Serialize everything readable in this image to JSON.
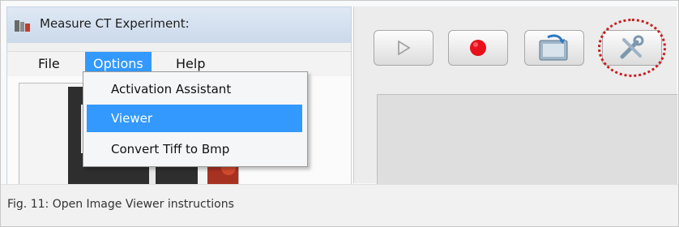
{
  "window": {
    "title": "Measure CT Experiment:"
  },
  "menubar": {
    "items": [
      {
        "label": "File"
      },
      {
        "label": "Options"
      },
      {
        "label": "Help"
      }
    ],
    "active_item": "Options"
  },
  "options_menu": {
    "items": [
      {
        "label": "Activation Assistant",
        "selected": false
      },
      {
        "label": "Viewer",
        "selected": true
      },
      {
        "label": "Convert Tiff to Bmp",
        "selected": false
      }
    ]
  },
  "toolbar": {
    "buttons": [
      {
        "icon": "play-icon"
      },
      {
        "icon": "record-icon"
      },
      {
        "icon": "export-image-icon"
      },
      {
        "icon": "tools-icon",
        "highlighted": true
      }
    ]
  },
  "colors": {
    "menu_highlight": "#3399ff",
    "record_red": "#e8101a",
    "annotation_ring": "#c81e1e"
  },
  "caption": {
    "text": "Fig. 11: Open Image Viewer instructions"
  }
}
